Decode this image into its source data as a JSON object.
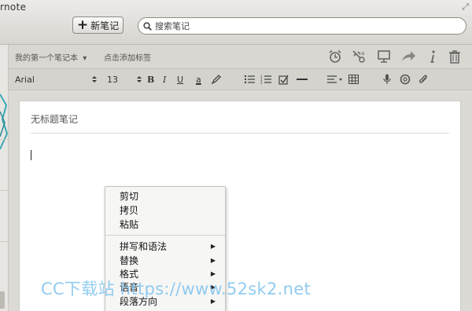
{
  "window": {
    "title": "rnote"
  },
  "toolbar": {
    "new_note_label": "新笔记",
    "search_placeholder": "搜索笔记"
  },
  "meta": {
    "notebook": "我的第一个笔记本",
    "notebook_caret": "▾",
    "tags_placeholder": "点击添加标签"
  },
  "format": {
    "font_family": "Arial",
    "font_size": "13",
    "bold": "B",
    "italic": "I",
    "underline": "U",
    "color": "a"
  },
  "editor": {
    "title_placeholder": "无标题笔记"
  },
  "context_menu": {
    "clipboard": [
      "剪切",
      "拷贝",
      "粘贴"
    ],
    "submenus": [
      "拼写和语法",
      "替换",
      "格式",
      "语音",
      "段落方向"
    ]
  },
  "watermark": "CC下载站 https://www.52sk2.net",
  "colors": {
    "accent_teal": "#3aa9b6",
    "watermark": "#7fc3ee"
  },
  "icons": [
    "expand-icon",
    "plus-icon",
    "search-icon",
    "reminder-icon",
    "share-icon",
    "present-icon",
    "forward-icon",
    "info-icon",
    "trash-icon",
    "bulleted-list-icon",
    "numbered-list-icon",
    "checkbox-icon",
    "horizontal-rule-icon",
    "align-icon",
    "table-icon",
    "microphone-icon",
    "camera-icon",
    "attachment-icon",
    "submenu-arrow-icon"
  ]
}
